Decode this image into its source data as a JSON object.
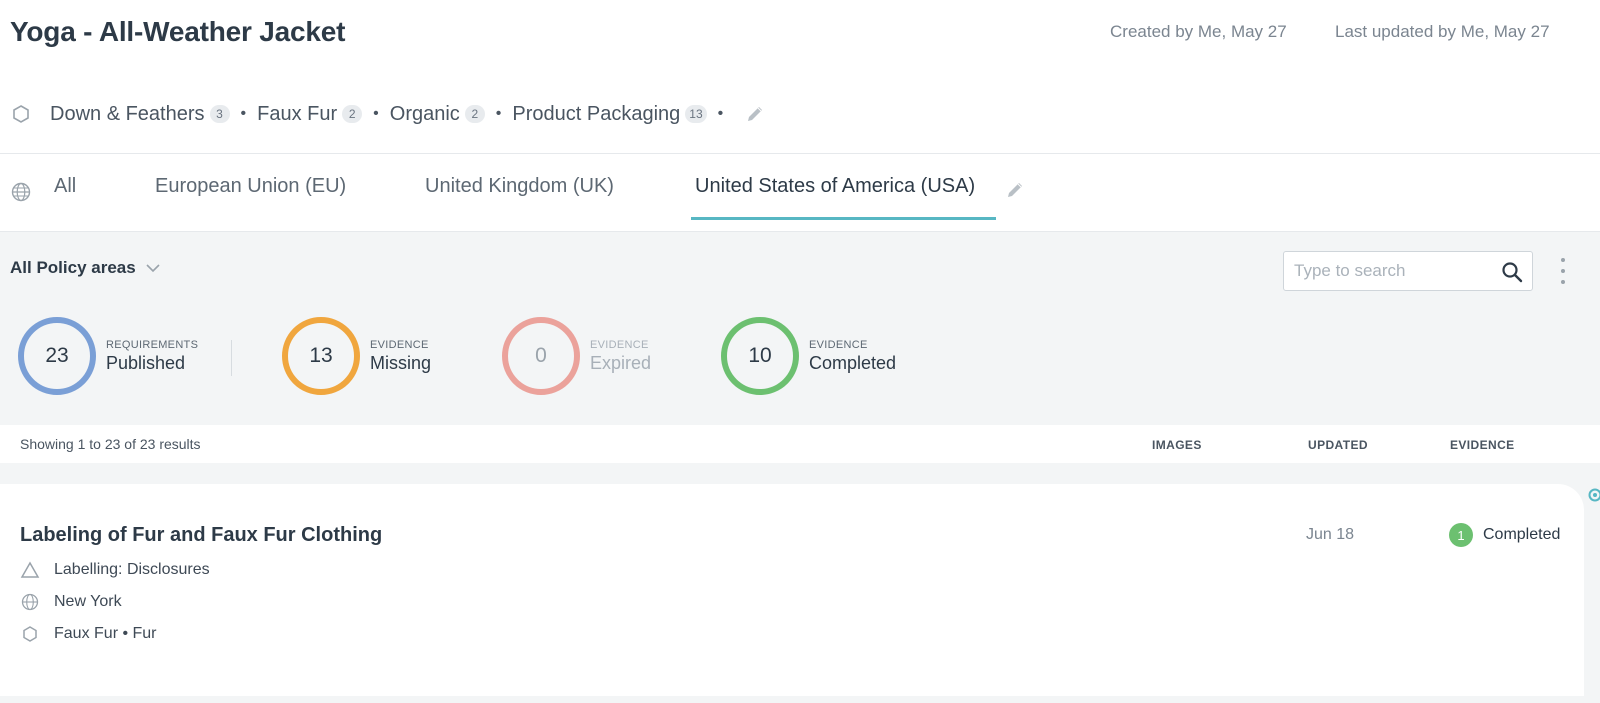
{
  "header": {
    "title": "Yoga - All-Weather Jacket",
    "created": "Created by Me, May 27",
    "updated": "Last updated by Me, May 27"
  },
  "materials": [
    {
      "label": "Down & Feathers",
      "count": "3"
    },
    {
      "label": "Faux Fur",
      "count": "2"
    },
    {
      "label": "Organic",
      "count": "2"
    },
    {
      "label": "Product Packaging",
      "count": "13"
    }
  ],
  "tabs": [
    {
      "label": "All",
      "active": false
    },
    {
      "label": "European Union (EU)",
      "active": false
    },
    {
      "label": "United Kingdom (UK)",
      "active": false
    },
    {
      "label": "United States of America (USA)",
      "active": true
    }
  ],
  "filters": {
    "policy_label": "All Policy areas",
    "search_placeholder": "Type to search"
  },
  "stats": [
    {
      "value": "23",
      "small": "REQUIREMENTS",
      "big": "Published",
      "color": "#7a9fd6"
    },
    {
      "value": "13",
      "small": "EVIDENCE",
      "big": "Missing",
      "color": "#f0a63e"
    },
    {
      "value": "0",
      "small": "EVIDENCE",
      "big": "Expired",
      "color": "#eba29b"
    },
    {
      "value": "10",
      "small": "EVIDENCE",
      "big": "Completed",
      "color": "#6cc070"
    }
  ],
  "results": {
    "showing": "Showing 1 to 23 of 23 results",
    "col_images": "IMAGES",
    "col_updated": "UPDATED",
    "col_evidence": "EVIDENCE"
  },
  "rows": [
    {
      "title": "Labeling of Fur and Faux Fur Clothing",
      "updated": "Jun 18",
      "evidence_count": "1",
      "evidence_status": "Completed",
      "policy": "Labelling: Disclosures",
      "region": "New York",
      "materials": "Faux Fur • Fur"
    }
  ],
  "colors": {
    "accent_tab": "#57b7c3",
    "text_dark": "#2d3a47",
    "panel_bg": "#f3f5f6"
  }
}
